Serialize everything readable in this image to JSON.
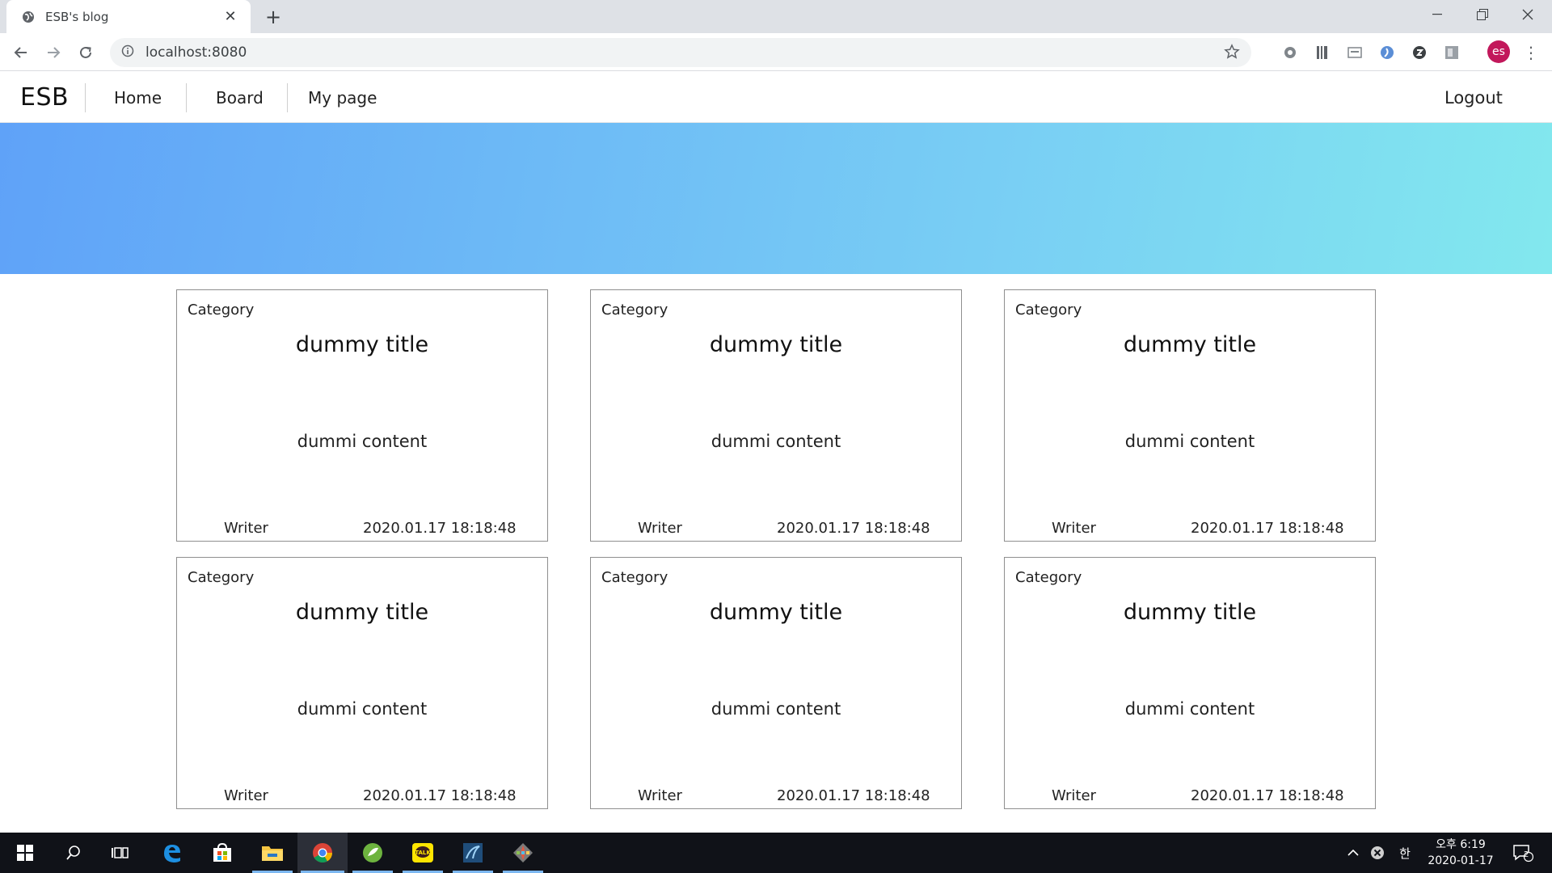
{
  "browser": {
    "tab_title": "ESB's blog",
    "url": "localhost:8080",
    "profile_initials": "es"
  },
  "nav": {
    "brand": "ESB",
    "links": [
      "Home",
      "Board",
      "My page"
    ],
    "logout": "Logout"
  },
  "colors": {
    "hero_gradient_start": "#5fa2f8",
    "hero_gradient_end": "#82e8ee",
    "profile": "#c2185b",
    "taskbar": "#101218"
  },
  "cards": [
    {
      "category": "Category",
      "title": "dummy title",
      "content": "dummi content",
      "writer": "Writer",
      "date": "2020.01.17 18:18:48"
    },
    {
      "category": "Category",
      "title": "dummy title",
      "content": "dummi content",
      "writer": "Writer",
      "date": "2020.01.17 18:18:48"
    },
    {
      "category": "Category",
      "title": "dummy title",
      "content": "dummi content",
      "writer": "Writer",
      "date": "2020.01.17 18:18:48"
    },
    {
      "category": "Category",
      "title": "dummy title",
      "content": "dummi content",
      "writer": "Writer",
      "date": "2020.01.17 18:18:48"
    },
    {
      "category": "Category",
      "title": "dummy title",
      "content": "dummi content",
      "writer": "Writer",
      "date": "2020.01.17 18:18:48"
    },
    {
      "category": "Category",
      "title": "dummy title",
      "content": "dummi content",
      "writer": "Writer",
      "date": "2020.01.17 18:18:48"
    }
  ],
  "taskbar": {
    "ime": "한",
    "time": "오후 6:19",
    "date": "2020-01-17",
    "notification_count": "2"
  }
}
